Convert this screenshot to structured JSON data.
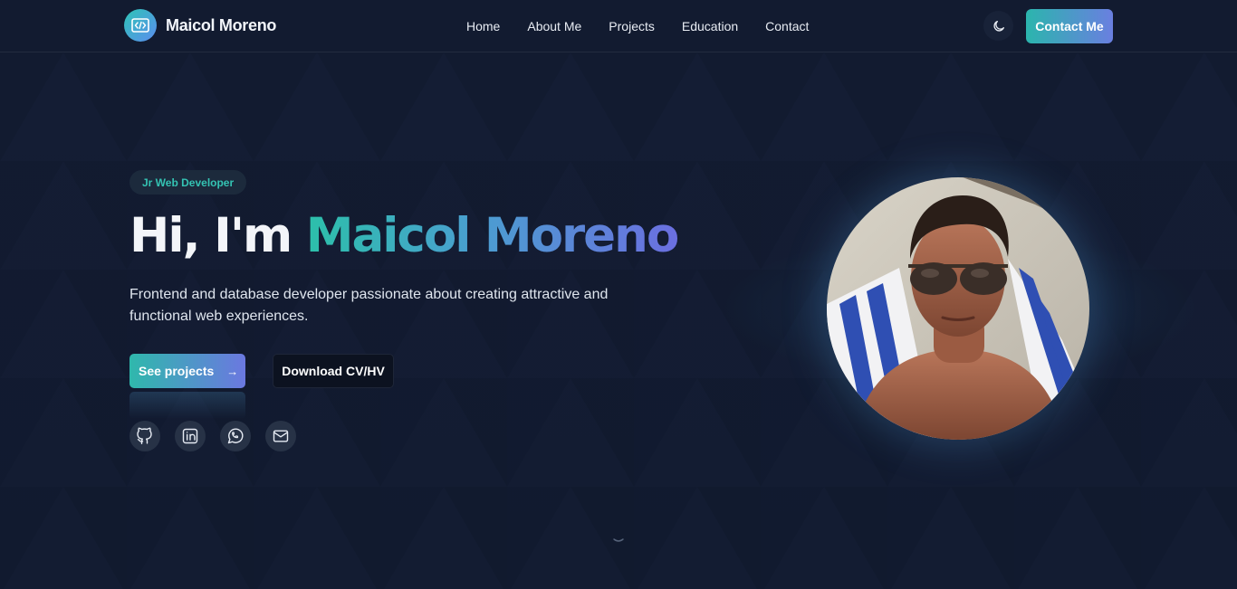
{
  "nav": {
    "brand": "Maicol Moreno",
    "links": [
      "Home",
      "About Me",
      "Projects",
      "Education",
      "Contact"
    ],
    "contact_label": "Contact Me"
  },
  "hero": {
    "badge": "Jr Web Developer",
    "greeting": "Hi, I'm ",
    "name": "Maicol Moreno",
    "tagline": "Frontend and database developer passionate about creating attractive and functional web experiences.",
    "primary_button": "See projects",
    "primary_arrow": "→",
    "secondary_button": "Download CV/HV",
    "socials": [
      "github-icon",
      "linkedin-icon",
      "whatsapp-icon",
      "mail-icon"
    ]
  },
  "colors": {
    "background": "#111a2e",
    "accent_teal": "#2ec4b6",
    "accent_violet": "#6b6fe0"
  }
}
